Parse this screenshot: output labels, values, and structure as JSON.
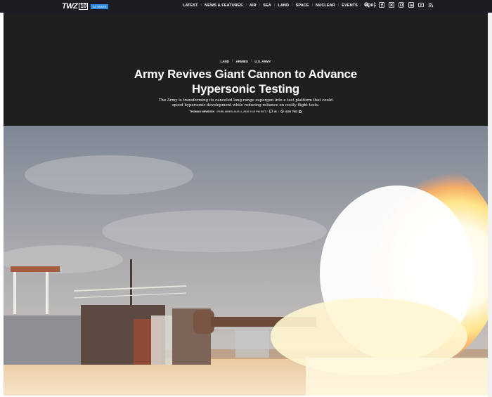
{
  "header": {
    "logo": "TWZ",
    "logo_number": "10",
    "logo_badge": "10 YEARS",
    "nav": [
      "LATEST",
      "NEWS & FEATURES",
      "AIR",
      "SEA",
      "LAND",
      "SPACE",
      "NUCLEAR",
      "EVENTS",
      "MORE"
    ],
    "icons": [
      "search-icon",
      "facebook-icon",
      "x-icon",
      "instagram-icon",
      "linkedin-icon",
      "youtube-icon",
      "rss-icon"
    ]
  },
  "article": {
    "breadcrumbs": [
      "LAND",
      "ARMIES",
      "U.S. ARMY"
    ],
    "title": "Army Revives Giant Cannon to Advance Hypersonic Testing",
    "dek": "The Army is transforming its canceled long-range supergun into a test platform that could speed hypersonic development while reducing reliance on costly flight tests.",
    "byline": {
      "author": "THOMAS NEWDICK",
      "published": "/ PUBLISHED AUG 4, 2026 9:15 PM EDT /",
      "comments": "26",
      "add_label": "ADD TWZ"
    }
  },
  "colors": {
    "nav_bg": "#1b1d22",
    "hero_bg": "#1f1f1f",
    "badge": "#2f8de4"
  }
}
